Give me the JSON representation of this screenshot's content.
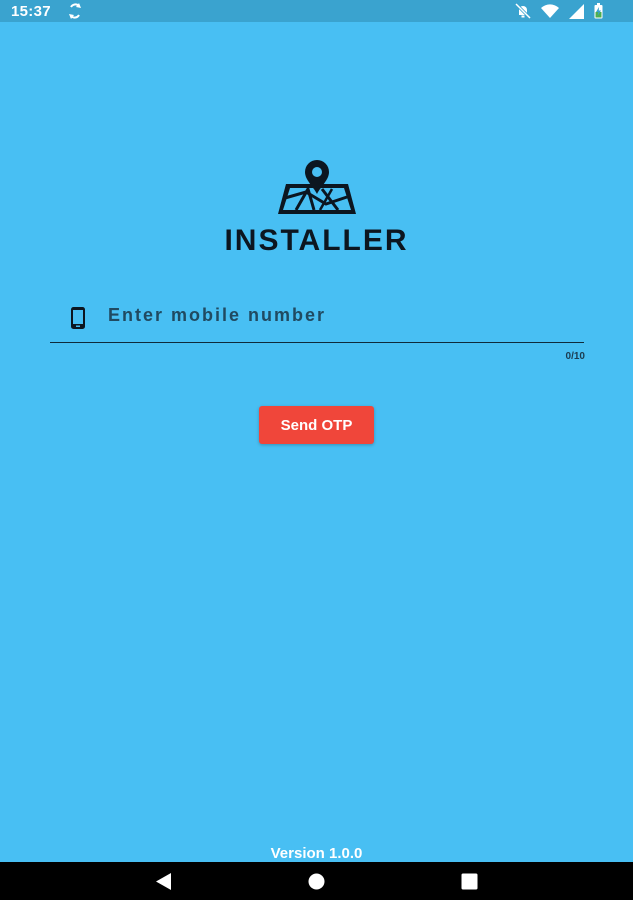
{
  "status_bar": {
    "time": "15:37",
    "icons": [
      "sync-icon",
      "mute-icon",
      "wifi-icon",
      "signal-icon",
      "battery-charging-icon"
    ]
  },
  "app": {
    "logo_icon": "map-location-pin-icon",
    "title": "INSTALLER"
  },
  "login_form": {
    "mobile_placeholder": "Enter mobile number",
    "mobile_value": "",
    "field_icon": "mobile-phone-icon",
    "char_counter": "0/10",
    "send_otp_label": "Send OTP"
  },
  "footer": {
    "version": "Version 1.0.0"
  },
  "nav_bar": {
    "buttons": [
      "back-icon",
      "home-icon",
      "recents-icon"
    ]
  },
  "colors": {
    "background": "#48bff3",
    "status_bar": "#3aa3cf",
    "button": "#f0463a",
    "title": "#0c1620"
  }
}
